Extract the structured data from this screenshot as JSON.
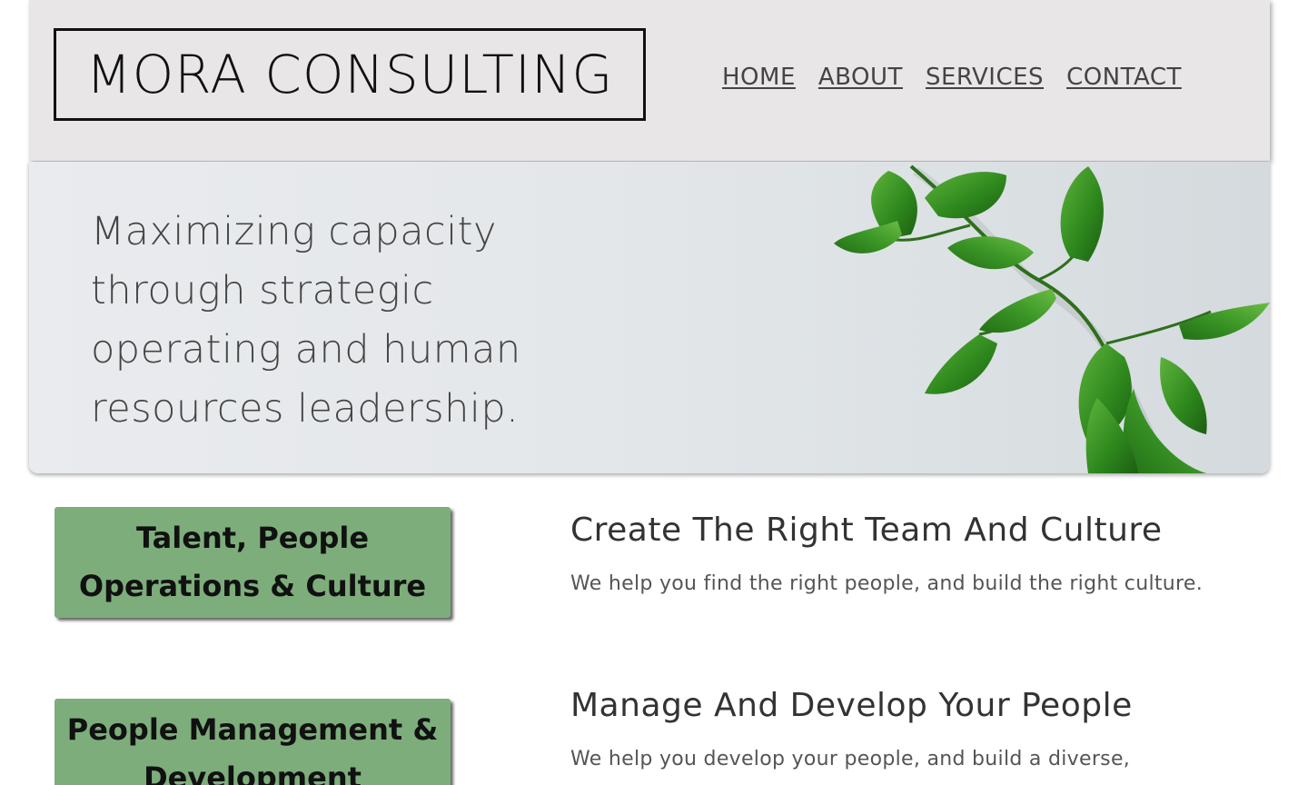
{
  "header": {
    "logo_text": "MORA CONSULTING",
    "nav": [
      {
        "label": "HOME"
      },
      {
        "label": "ABOUT"
      },
      {
        "label": "SERVICES"
      },
      {
        "label": "CONTACT"
      }
    ]
  },
  "hero": {
    "line1": "Maximizing capacity",
    "line2": "through strategic",
    "line3": "operating and human",
    "line4": "resources leadership.",
    "image": "green-plant-leaves-image"
  },
  "services": [
    {
      "button_line1": "Talent, People",
      "button_line2": "Operations & Culture",
      "heading": "Create The Right Team And Culture",
      "description": "We help you find the right people, and build the right culture."
    },
    {
      "button_line1": "People Management &",
      "button_line2": "Development",
      "heading": "Manage And Develop Your People",
      "description": "We help you develop your people, and build a diverse,"
    }
  ],
  "colors": {
    "header_bg": "#e8e6e7",
    "button_green": "#7dad7b",
    "text_dark": "#333333"
  }
}
